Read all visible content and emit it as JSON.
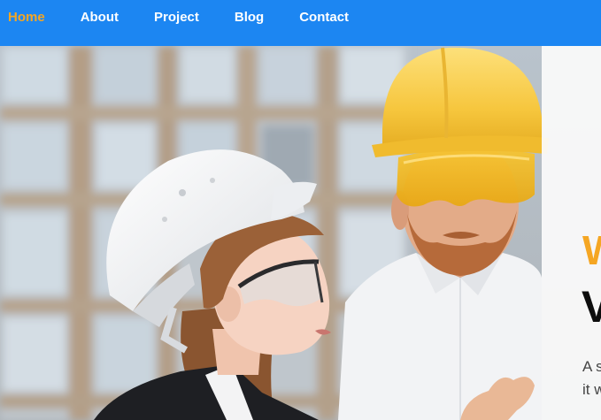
{
  "nav": {
    "items": [
      {
        "label": "Home",
        "active": true
      },
      {
        "label": "About",
        "active": false
      },
      {
        "label": "Project",
        "active": false
      },
      {
        "label": "Blog",
        "active": false
      },
      {
        "label": "Contact",
        "active": false
      }
    ]
  },
  "hero": {
    "eyebrow": "W",
    "title": "V",
    "text_line_1": "A s",
    "text_line_2": "it w"
  },
  "colors": {
    "nav_background": "#1c86f2",
    "nav_active": "#f5a623",
    "nav_text": "#ffffff",
    "eyebrow": "#f5a623",
    "title": "#0d0d0d"
  }
}
